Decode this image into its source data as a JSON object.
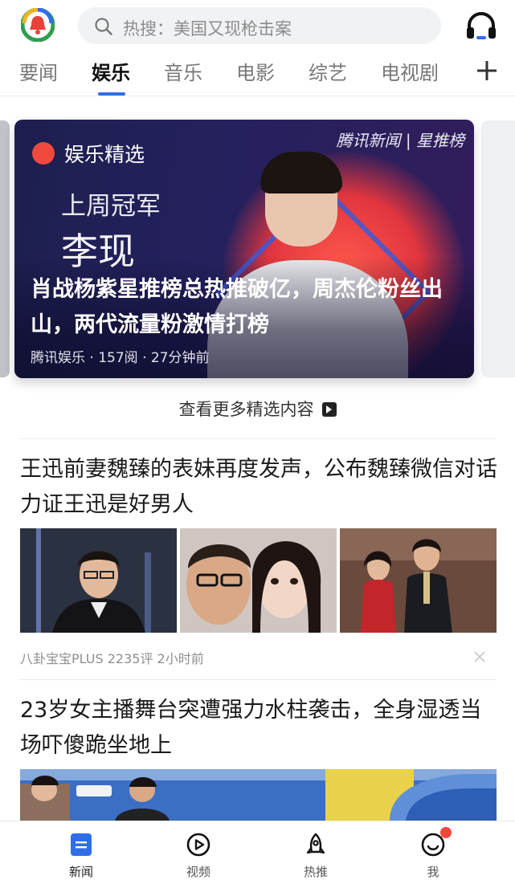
{
  "header": {
    "search_placeholder": "热搜：美国又现枪击案",
    "logo_icon": "tencent-news-logo-icon",
    "audio_icon": "headset-icon"
  },
  "tabs": [
    {
      "label": "要闻",
      "active": false
    },
    {
      "label": "娱乐",
      "active": true
    },
    {
      "label": "音乐",
      "active": false
    },
    {
      "label": "电影",
      "active": false
    },
    {
      "label": "综艺",
      "active": false
    },
    {
      "label": "电视剧",
      "active": false
    }
  ],
  "feature": {
    "badge": "娱乐精选",
    "brand": "腾讯新闻 | 星推榜",
    "champ_label": "上周冠军",
    "champ_name": "李现",
    "title": "肖战杨紫星推榜总热推破亿，周杰伦粉丝出山，两代流量粉激情打榜",
    "meta": "腾讯娱乐 · 157阅 · 27分钟前"
  },
  "more_link": "查看更多精选内容",
  "articles": [
    {
      "title": "王迅前妻魏臻的表妹再度发声，公布魏臻微信对话力证王迅是好男人",
      "meta": "八卦宝宝PLUS  2235评  2小时前"
    },
    {
      "title": "23岁女主播舞台突遭强力水柱袭击，全身湿透当场吓傻跪坐地上"
    }
  ],
  "bottom_nav": [
    {
      "label": "新闻",
      "icon": "news-icon",
      "active": true
    },
    {
      "label": "视频",
      "icon": "video-play-icon",
      "active": false
    },
    {
      "label": "热推",
      "icon": "rocket-icon",
      "active": false
    },
    {
      "label": "我",
      "icon": "smiley-profile-icon",
      "active": false
    }
  ],
  "colors": {
    "accent": "#2f6ee6",
    "notification": "#f0473d"
  }
}
